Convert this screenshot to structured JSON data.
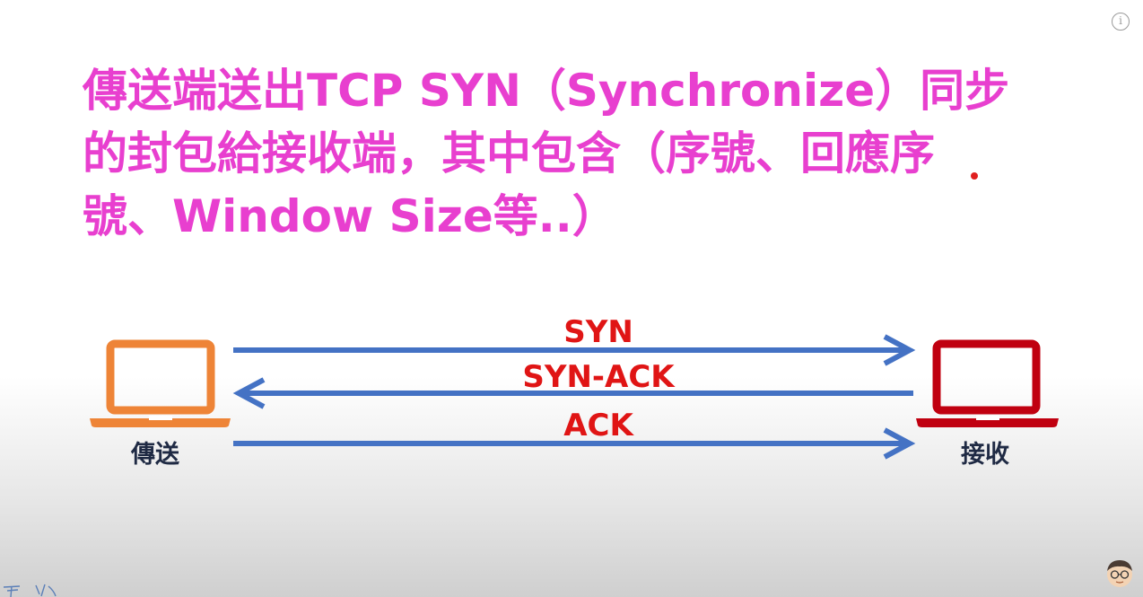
{
  "headline": {
    "line1": "傳送端送出TCP SYN（Synchronize）同步",
    "line2": "的封包給接收端，其中包含（序號、回應序",
    "line3": "號、Window Size等..）"
  },
  "nodes": {
    "sender": {
      "label": "傳送",
      "color": "#ee8437",
      "icon": "laptop-icon"
    },
    "receiver": {
      "label": "接收",
      "color": "#c00010",
      "icon": "laptop-icon"
    }
  },
  "messages": [
    {
      "label": "SYN",
      "direction": "sender-to-receiver"
    },
    {
      "label": "SYN-ACK",
      "direction": "receiver-to-sender"
    },
    {
      "label": "ACK",
      "direction": "sender-to-receiver"
    }
  ],
  "colors": {
    "headline": "#e83fcf",
    "arrow": "#4472c4",
    "message_label": "#e01515",
    "node_label": "#1f2a44"
  },
  "icons": {
    "info": "info-icon",
    "avatar": "avatar-icon"
  }
}
